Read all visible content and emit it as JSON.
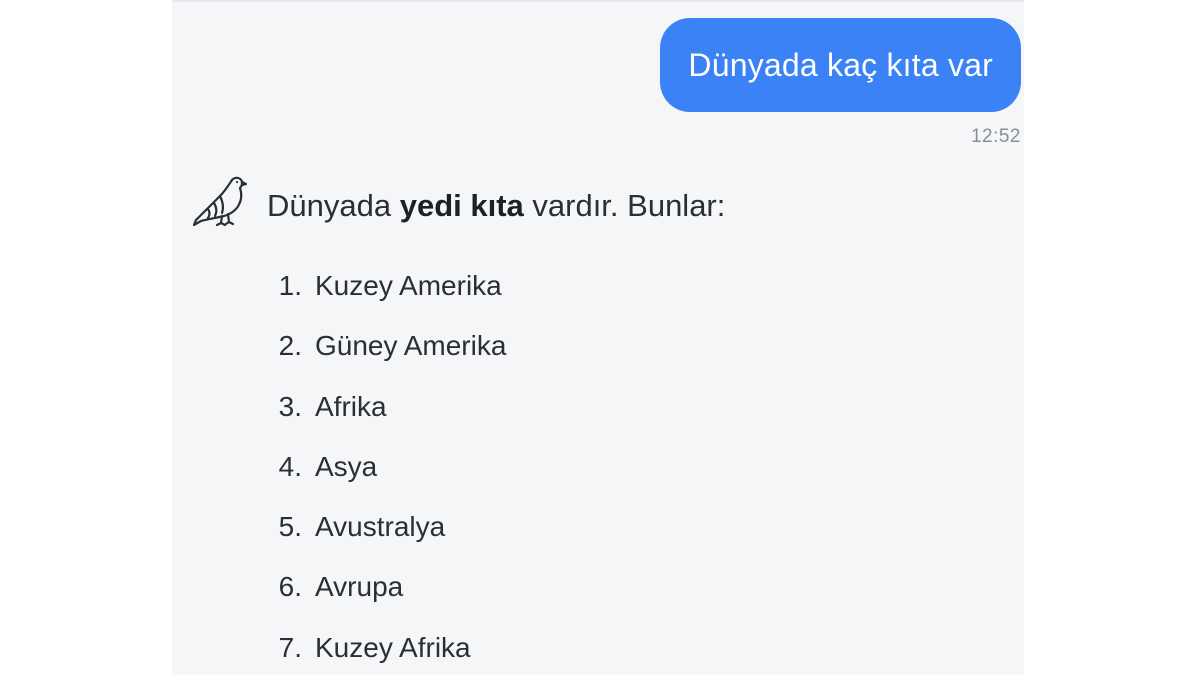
{
  "conversation": {
    "user_message": {
      "text": "Dünyada kaç kıta var",
      "time": "12:52"
    },
    "bot_message": {
      "avatar_icon": "dove-icon",
      "intro_before": "Dünyada ",
      "intro_bold": "yedi kıta",
      "intro_after": " vardır. Bunlar:",
      "items": [
        {
          "number": "1.",
          "label": "Kuzey Amerika"
        },
        {
          "number": "2.",
          "label": "Güney Amerika"
        },
        {
          "number": "3.",
          "label": "Afrika"
        },
        {
          "number": "4.",
          "label": "Asya"
        },
        {
          "number": "5.",
          "label": "Avustralya"
        },
        {
          "number": "6.",
          "label": "Avrupa"
        },
        {
          "number": "7.",
          "label": "Kuzey Afrika"
        }
      ]
    }
  },
  "colors": {
    "bubble": "#3b82f6",
    "panel": "#f5f6f8",
    "text": "#2b2f33",
    "timestamp": "#8a8f96"
  }
}
